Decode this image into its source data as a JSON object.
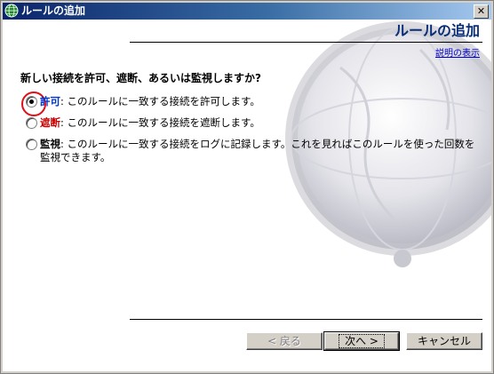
{
  "window": {
    "title": "ルールの追加",
    "close_glyph": "✕"
  },
  "header": {
    "title": "ルールの追加",
    "help_link": "説明の表示"
  },
  "question": "新しい接続を許可、遮断、あるいは監視しますか?",
  "options": [
    {
      "keyword": "許可",
      "description": ": このルールに一致する接続を許可します。",
      "selected": true,
      "keyword_color": "#0033cc"
    },
    {
      "keyword": "遮断",
      "description": ": このルールに一致する接続を遮断します。",
      "selected": false,
      "keyword_color": "#cc0000"
    },
    {
      "keyword": "監視",
      "description": ": このルールに一致する接続をログに記録します。これを見ればこのルールを使った回数を監視できます。",
      "selected": false,
      "keyword_color": "#000000"
    }
  ],
  "buttons": {
    "back": "< 戻る",
    "next": "次へ >",
    "cancel": "キャンセル"
  },
  "colors": {
    "titlebar_start": "#0a246a",
    "highlight_ring": "#e0101a",
    "header_title": "#0a2e78"
  }
}
